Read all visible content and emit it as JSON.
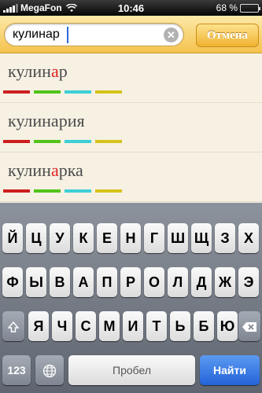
{
  "status_bar": {
    "carrier": "MegaFon",
    "time": "10:46",
    "battery_text": "68 %",
    "battery_level": 0.68
  },
  "search": {
    "query": "кулинар",
    "cancel_label": "Отмена"
  },
  "results": [
    {
      "prefix": "кулин",
      "highlight": "а",
      "suffix": "р"
    },
    {
      "prefix": "кулинария",
      "highlight": "",
      "suffix": ""
    },
    {
      "prefix": "кулин",
      "highlight": "а",
      "suffix": "рка"
    }
  ],
  "bar_colors": [
    "#cc1f1f",
    "#52c41a",
    "#3ccfd6",
    "#d6c21a"
  ],
  "keyboard": {
    "row1": [
      "Й",
      "Ц",
      "У",
      "К",
      "Е",
      "Н",
      "Г",
      "Ш",
      "Щ",
      "З",
      "Х"
    ],
    "row2": [
      "Ф",
      "Ы",
      "В",
      "А",
      "П",
      "Р",
      "О",
      "Л",
      "Д",
      "Ж",
      "Э"
    ],
    "row3": [
      "Я",
      "Ч",
      "С",
      "М",
      "И",
      "Т",
      "Ь",
      "Б",
      "Ю"
    ],
    "numbers_label": "123",
    "space_label": "Пробел",
    "go_label": "Найти"
  }
}
